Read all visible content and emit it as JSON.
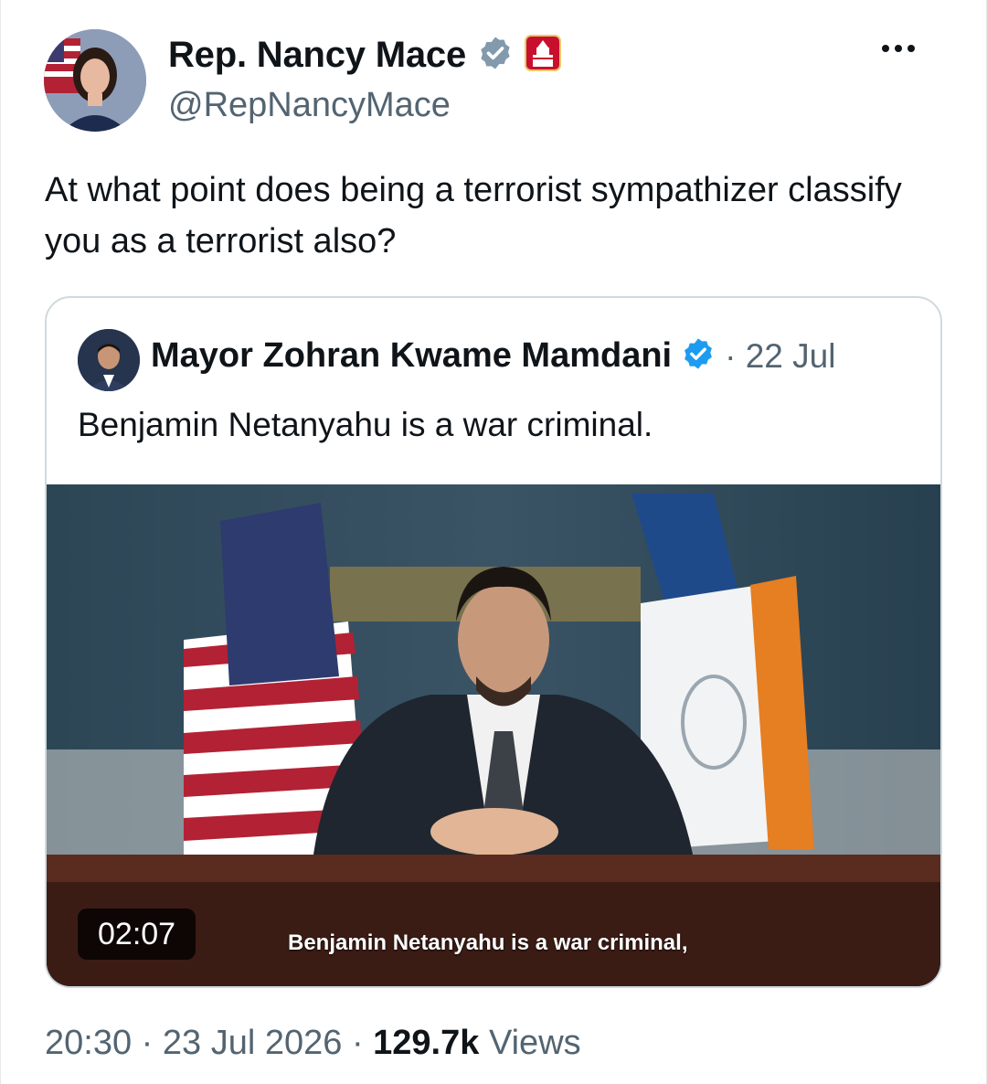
{
  "tweet": {
    "author_name": "Rep. Nancy Mace",
    "author_handle": "@RepNancyMace",
    "text": "At what point does being a terrorist sympathizer classify you as a terrorist also?",
    "badge_icons": [
      "verified-icon",
      "house-gop-badge-icon"
    ],
    "more_icon": "more-options-icon",
    "time": "20:30",
    "sep": "·",
    "date": "23 Jul 2026",
    "views_count": "129.7k",
    "views_label": "Views"
  },
  "quote": {
    "author_name": "Mayor Zohran Kwame Mamdani",
    "date_meta": "· 22 Jul",
    "text": "Benjamin Netanyahu is a war criminal.",
    "video": {
      "duration": "02:07",
      "subtitle": "Benjamin Netanyahu is a war criminal,"
    }
  },
  "colors": {
    "verified": "#1d9bf0",
    "muted": "#536471",
    "text": "#0f1419",
    "border": "#cfd9de"
  }
}
